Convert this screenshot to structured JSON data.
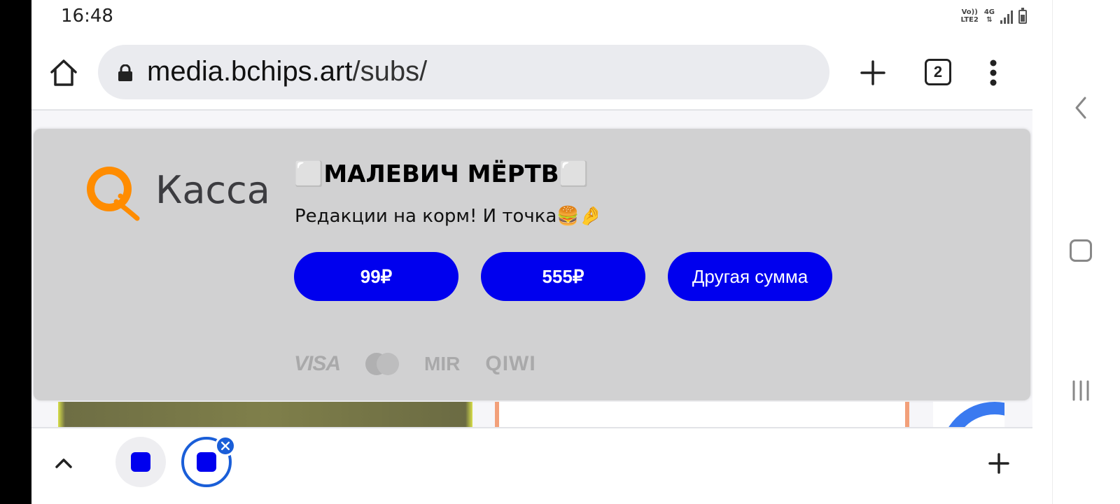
{
  "status_bar": {
    "time": "16:48",
    "volte_line1": "Vo))",
    "volte_line2": "LTE2",
    "network": "4G"
  },
  "browser": {
    "url_host": "media.bchips.art",
    "url_path": "/subs/",
    "tab_count": "2"
  },
  "payment_card": {
    "logo_text": "Касса",
    "title": "⬜МАЛЕВИЧ МЁРТВ⬜",
    "subtitle": "Редакции на корм! И точка🍔🤌",
    "amount_buttons": [
      {
        "label": "99₽"
      },
      {
        "label": "555₽"
      },
      {
        "label": "Другая сумма"
      }
    ],
    "payment_methods": {
      "visa": "VISA",
      "mir": "MIR",
      "qiwi": "QIWI"
    }
  },
  "colors": {
    "button_blue": "#0000ee",
    "qiwi_orange": "#ff8c00",
    "card_bg": "#d1d1d2",
    "tab_accent": "#1a5ed8"
  },
  "icons": {
    "toolbar": [
      "home-icon",
      "lock-icon",
      "plus-icon",
      "tab-switcher-icon",
      "more-vert-icon"
    ],
    "bottom": [
      "chevron-up-icon",
      "close-icon",
      "plus-icon"
    ],
    "nav": [
      "back-icon",
      "home-square-icon",
      "recent-apps-icon"
    ]
  }
}
